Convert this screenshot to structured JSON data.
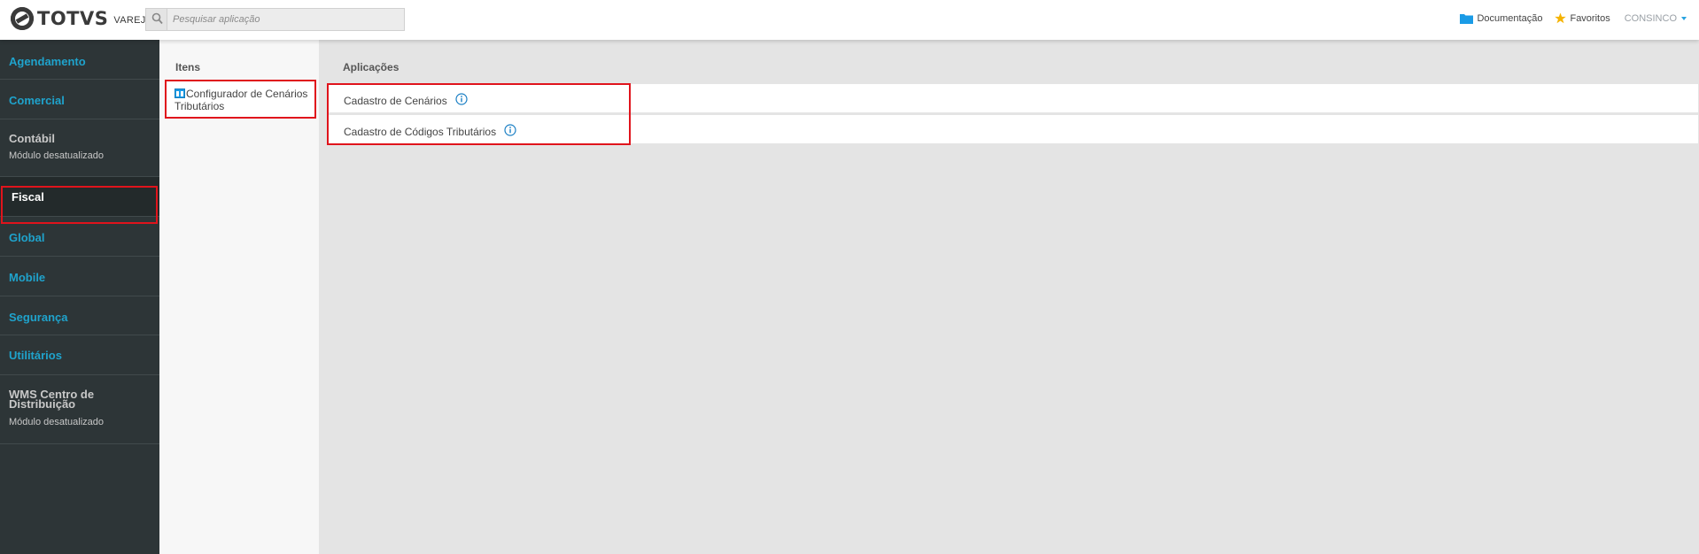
{
  "header": {
    "logo_text": "TOTVS",
    "logo_sub": "VAREJO",
    "search_placeholder": "Pesquisar aplicação",
    "doc_label": "Documentação",
    "fav_label": "Favoritos",
    "user_label": "CONSINCO"
  },
  "sidebar": {
    "items": [
      {
        "label": "Agendamento"
      },
      {
        "label": "Comercial"
      },
      {
        "label": "Contábil",
        "sub": "Módulo desatualizado"
      },
      {
        "label": "Fiscal"
      },
      {
        "label": "Global"
      },
      {
        "label": "Mobile"
      },
      {
        "label": "Segurança"
      },
      {
        "label": "Utilitários"
      },
      {
        "label": "WMS Centro de Distribuição",
        "sub": "Módulo desatualizado"
      }
    ]
  },
  "items_panel": {
    "title": "Itens",
    "entry": "Configurador de Cenários Tributários"
  },
  "apps_panel": {
    "title": "Aplicações",
    "rows": [
      {
        "label": "Cadastro de Cenários"
      },
      {
        "label": "Cadastro de Códigos Tributários"
      }
    ]
  },
  "colors": {
    "accent": "#1fa3cc",
    "sidebar_bg": "#2d3537",
    "highlight": "#e0141c",
    "folder": "#1a9be6",
    "star": "#f5b301"
  }
}
